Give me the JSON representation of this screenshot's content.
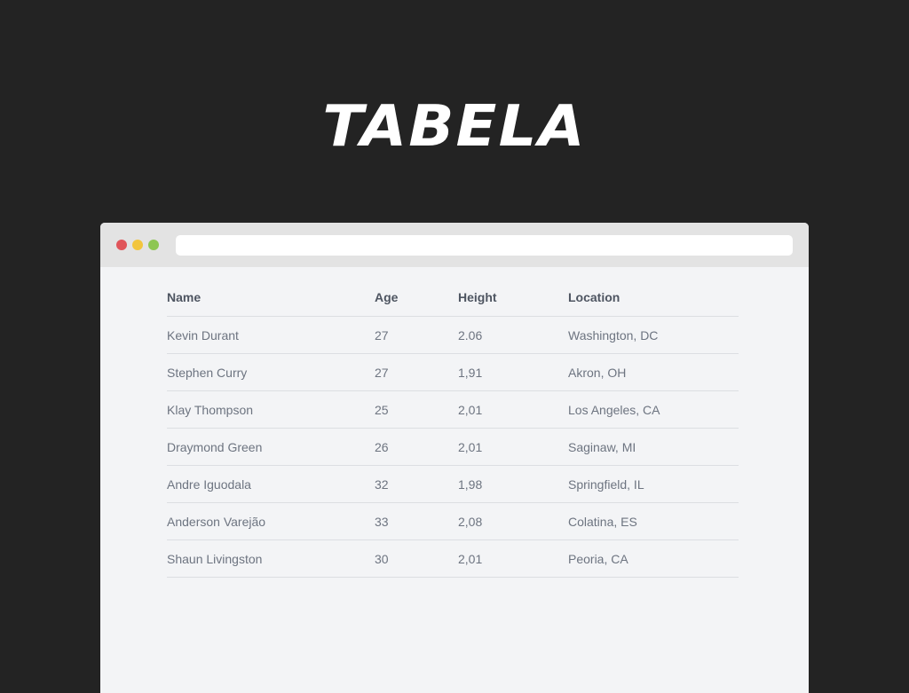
{
  "page": {
    "title": "TABELA"
  },
  "browser": {
    "traffic_lights": [
      "close",
      "minimize",
      "maximize"
    ],
    "address_bar_value": ""
  },
  "table": {
    "columns": [
      "Name",
      "Age",
      "Height",
      "Location"
    ],
    "rows": [
      [
        "Kevin Durant",
        "27",
        "2.06",
        "Washington, DC"
      ],
      [
        "Stephen Curry",
        "27",
        "1,91",
        "Akron, OH"
      ],
      [
        "Klay Thompson",
        "25",
        "2,01",
        "Los Angeles, CA"
      ],
      [
        "Draymond Green",
        "26",
        "2,01",
        "Saginaw, MI"
      ],
      [
        "Andre Iguodala",
        "32",
        "1,98",
        "Springfield, IL"
      ],
      [
        "Anderson Varejão",
        "33",
        "2,08",
        "Colatina, ES"
      ],
      [
        "Shaun Livingston",
        "30",
        "2,01",
        "Peoria, CA"
      ]
    ]
  },
  "colors": {
    "background": "#232323",
    "window": "#f3f4f6",
    "titlebar": "#e3e3e3",
    "close": "#e0555a",
    "minimize": "#f2c53d",
    "maximize": "#8dc652",
    "header_text": "#4e5561",
    "cell_text": "#6d7480",
    "divider": "#dcdee2"
  }
}
